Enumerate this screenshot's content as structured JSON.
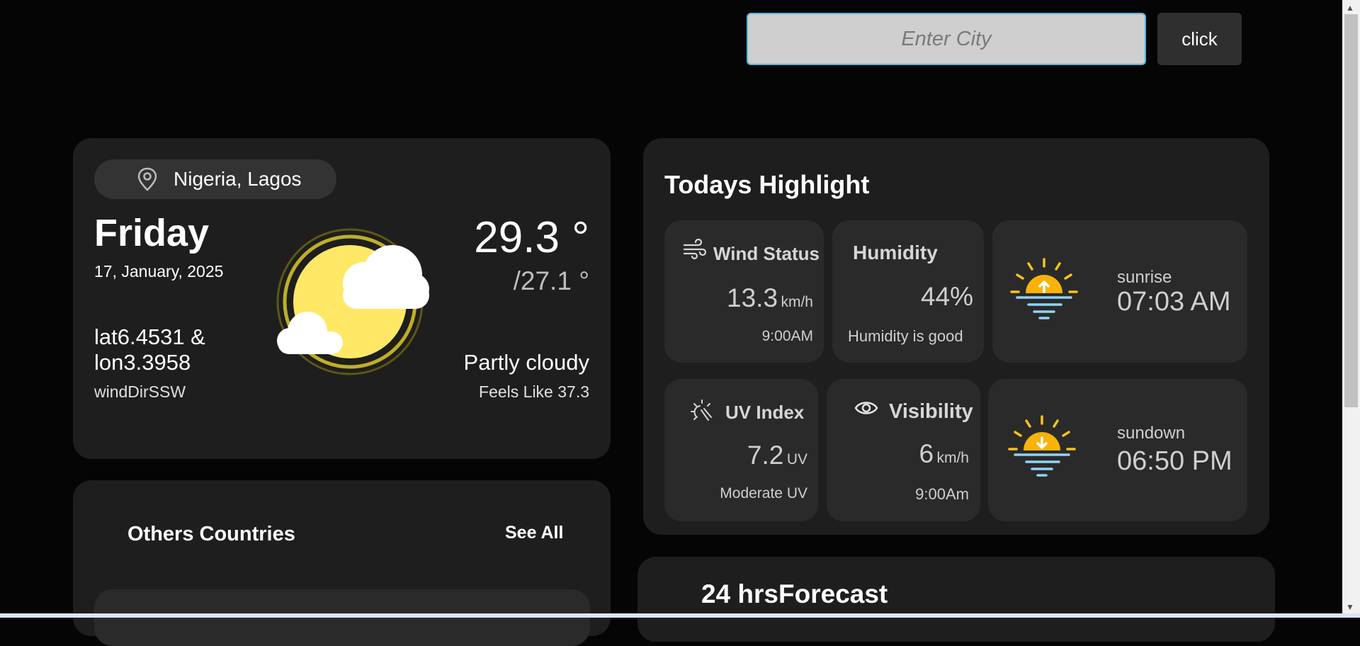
{
  "search": {
    "placeholder": "Enter City",
    "button_label": "click"
  },
  "current": {
    "location": "Nigeria, Lagos",
    "day": "Friday",
    "date": "17, January, 2025",
    "latlon": "lat6.4531 & lon3.3958",
    "wind_dir": "windDirSSW",
    "temp": "29.3 °",
    "temp_min": "/27.1 °",
    "condition": "Partly cloudy",
    "feels_like": "Feels Like 37.3",
    "icon": "partly-cloudy-icon"
  },
  "others": {
    "title": "Others Countries",
    "see_all": "See All"
  },
  "highlights": {
    "title": "Todays Highlight",
    "wind": {
      "label": "Wind Status",
      "value": "13.3",
      "unit": "km/h",
      "time": "9:00AM",
      "icon": "wind-icon"
    },
    "humidity": {
      "label": "Humidity",
      "value": "44%",
      "note": "Humidity is good"
    },
    "sunrise": {
      "label": "sunrise",
      "time": "07:03 AM",
      "icon": "sunrise-icon"
    },
    "uv": {
      "label": "UV Index",
      "value": "7.2",
      "unit": "UV",
      "note": "Moderate UV",
      "icon": "uv-icon"
    },
    "visibility": {
      "label": "Visibility",
      "value": "6",
      "unit": "km/h",
      "time": "9:00Am",
      "icon": "eye-icon"
    },
    "sundown": {
      "label": "sundown",
      "time": "06:50 PM",
      "icon": "sunset-icon"
    }
  },
  "forecast": {
    "title": "24 hrsForecast"
  },
  "colors": {
    "background": "#050505",
    "card": "#1e1e1e",
    "tile": "#2a2a2a",
    "sun": "#ffe866",
    "accent_sun": "#f9b208",
    "water": "#8fd3f5"
  }
}
